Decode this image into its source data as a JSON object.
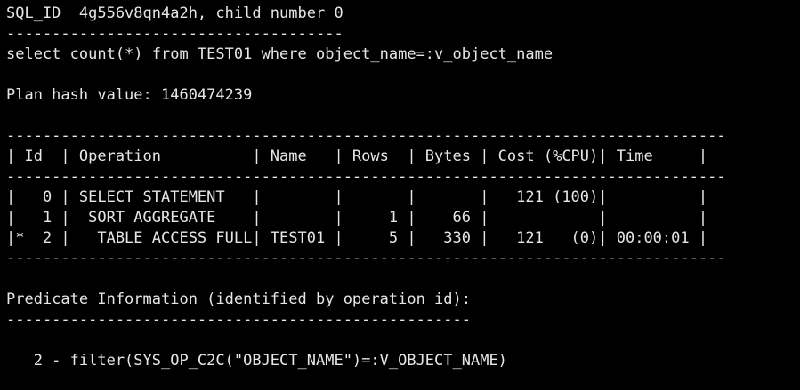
{
  "terminal": {
    "background": "#000000",
    "foreground": "#e6e6e6",
    "sql_id_line": "SQL_ID  4g556v8qn4a2h, child number 0",
    "sep_short": "-------------------------------------",
    "sql_text": "select count(*) from TEST01 where object_name=:v_object_name",
    "plan_hash": "Plan hash value: 1460474239",
    "plan_table": {
      "border": "-------------------------------------------------------------------------------",
      "header": "| Id  | Operation          | Name   | Rows  | Bytes | Cost (%CPU)| Time     |",
      "rows": [
        "|   0 | SELECT STATEMENT   |        |       |       |   121 (100)|          |",
        "|   1 |  SORT AGGREGATE    |        |     1 |    66 |            |          |",
        "|*  2 |   TABLE ACCESS FULL| TEST01 |     5 |   330 |   121   (0)| 00:00:01 |"
      ]
    },
    "predicate_title": "Predicate Information (identified by operation id):",
    "sep_predicate": "---------------------------------------------------",
    "predicate_line": "   2 - filter(SYS_OP_C2C(\"OBJECT_NAME\")=:V_OBJECT_NAME)"
  }
}
